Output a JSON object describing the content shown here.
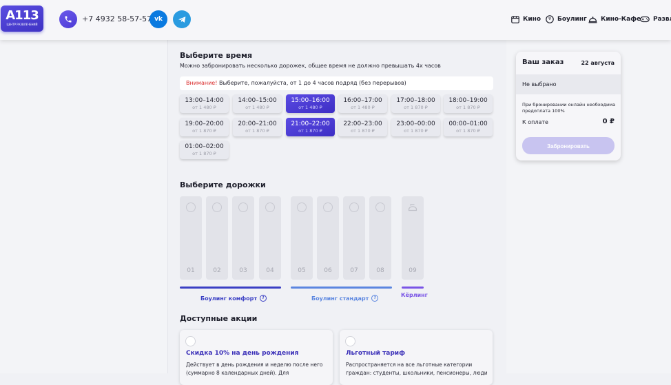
{
  "header": {
    "logo_main": "A113",
    "logo_sub": "ЦЕНТР РАЗВЛЕЧЕНИЙ",
    "phone": "+7 4932 58-57-57",
    "nav": [
      {
        "label": "Кино",
        "icon": "film-icon"
      },
      {
        "label": "Боулинг",
        "icon": "bowling-ball-icon"
      },
      {
        "label": "Кино-Кафе",
        "icon": "cloche-icon"
      },
      {
        "label": "Развлечения",
        "icon": "gamepad-icon"
      }
    ]
  },
  "time": {
    "title": "Выберите время",
    "subtitle": "Можно забронировать несколько дорожек, общее время не должно превышать 4х часов",
    "alert_warn": "Внимание!",
    "alert_text": " Выберите, пожалуйста, от 1 до 4 часов подряд (без перерывов)",
    "slots": [
      {
        "time": "13:00–14:00",
        "price": "от 1 480 ₽",
        "selected": false
      },
      {
        "time": "14:00–15:00",
        "price": "от 1 480 ₽",
        "selected": false
      },
      {
        "time": "15:00–16:00",
        "price": "от 1 480 ₽",
        "selected": true
      },
      {
        "time": "16:00–17:00",
        "price": "от 1 480 ₽",
        "selected": false
      },
      {
        "time": "17:00–18:00",
        "price": "от 1 870 ₽",
        "selected": false
      },
      {
        "time": "18:00–19:00",
        "price": "от 1 870 ₽",
        "selected": false
      },
      {
        "time": "19:00–20:00",
        "price": "от 1 870 ₽",
        "selected": false
      },
      {
        "time": "20:00–21:00",
        "price": "от 1 870 ₽",
        "selected": false
      },
      {
        "time": "21:00–22:00",
        "price": "от 1 870 ₽",
        "selected": true
      },
      {
        "time": "22:00–23:00",
        "price": "от 1 870 ₽",
        "selected": false
      },
      {
        "time": "23:00–00:00",
        "price": "от 1 870 ₽",
        "selected": false
      },
      {
        "time": "00:00–01:00",
        "price": "от 1 870 ₽",
        "selected": false
      },
      {
        "time": "01:00–02:00",
        "price": "от 1 870 ₽",
        "selected": false
      }
    ]
  },
  "lanes": {
    "title": "Выберите дорожки",
    "items": [
      "01",
      "02",
      "03",
      "04",
      "05",
      "06",
      "07",
      "08",
      "09"
    ],
    "groups": [
      {
        "label": "Боулинг комфорт",
        "color": "#3a3fc4"
      },
      {
        "label": "Боулинг стандарт",
        "color": "#5b86e0"
      },
      {
        "label": "Кёрлинг",
        "color": "#7a55e6"
      }
    ]
  },
  "promos": {
    "title": "Доступные акции",
    "items": [
      {
        "title": "Скидка 10% на день рождения",
        "desc": "Действует в день рождения и неделю после него (суммарно 8 календарных дней). Для"
      },
      {
        "title": "Льготный тариф",
        "desc": "Распространяется на все льготные категории граждан: студенты, школьники, пенсионеры, люди"
      }
    ]
  },
  "order": {
    "title": "Ваш заказ",
    "date": "22 августа",
    "status": "Не выбрано",
    "note": "При бронировании онлайн необходима предоплата 100%",
    "pay_label": "К оплате",
    "sum": "0 ₽",
    "button": "Забронировать"
  }
}
